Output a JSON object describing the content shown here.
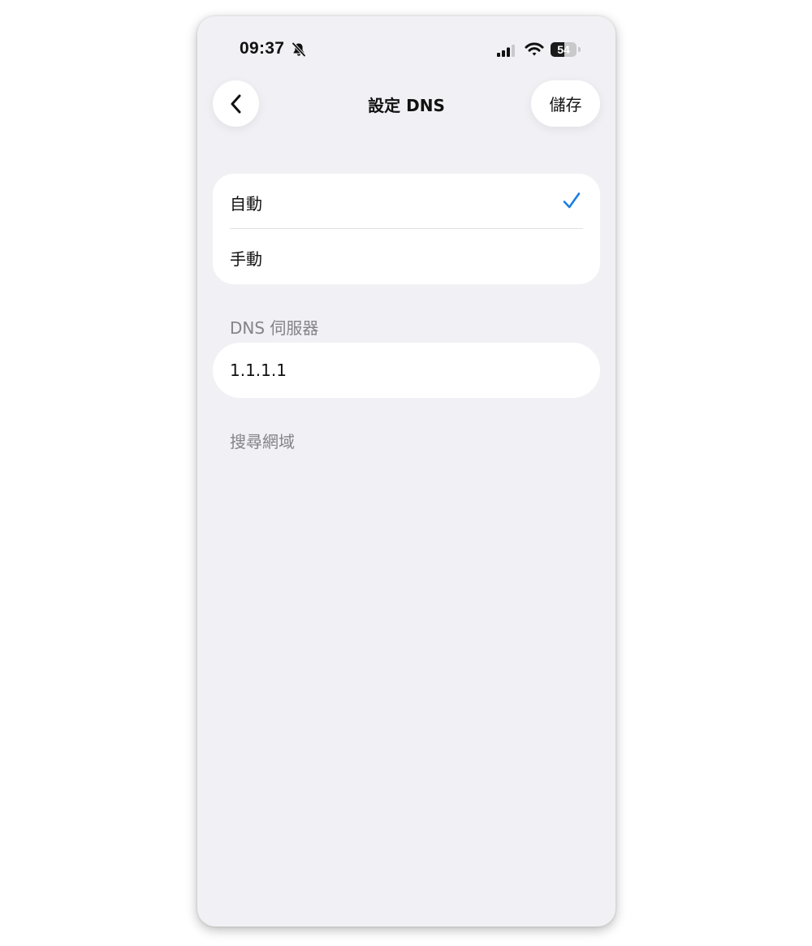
{
  "status_bar": {
    "time": "09:37",
    "battery_level": "54",
    "battery_fraction": 0.54
  },
  "header": {
    "title": "設定 DNS",
    "save_label": "儲存"
  },
  "dns_mode": {
    "options": [
      {
        "label": "自動",
        "selected": true
      },
      {
        "label": "手動",
        "selected": false
      }
    ]
  },
  "dns_servers": {
    "section_label": "DNS 伺服器",
    "value": "1.1.1.1"
  },
  "search_domains": {
    "section_label": "搜尋網域"
  },
  "colors": {
    "accent": "#1a7ee3",
    "background": "#f1f1f5",
    "card": "#ffffff",
    "secondary_text": "#838388"
  },
  "icons": [
    "chevron-left-icon",
    "bell-slash-icon",
    "signal-icon",
    "wifi-icon",
    "battery-icon",
    "checkmark-icon"
  ]
}
